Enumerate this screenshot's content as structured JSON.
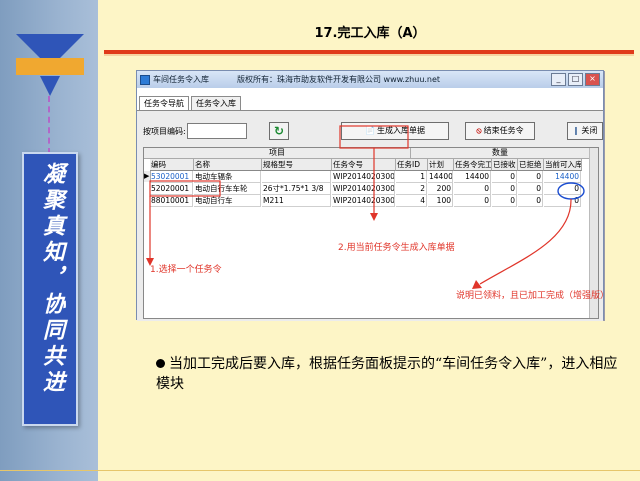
{
  "slide": {
    "title": "17.完工入库（A）",
    "sidebar_text": "凝聚真知，协同共进",
    "bullet": "当加工完成后要入库，根据任务面板提示的“车间任务令入库”，进入相应模块"
  },
  "window": {
    "title": "车间任务令入库",
    "copyright": "版权所有：珠海市助友软件开发有限公司 www.zhuu.net",
    "tabs": [
      "任务令导航",
      "任务令入库"
    ],
    "buttons": {
      "minimize": "_",
      "maximize": "□",
      "close": "×"
    }
  },
  "toolbar": {
    "project_code_label": "按项目编码:",
    "project_code_value": "",
    "generate_label": "生成入库单据",
    "end_task_label": "结束任务令",
    "close_label": "关闭"
  },
  "grid": {
    "group_headers": {
      "project": "项目",
      "quantity": "数量"
    },
    "columns": [
      "编码",
      "名称",
      "规格型号",
      "任务令号",
      "任务ID",
      "计划",
      "任务令完工",
      "已接收",
      "已拒绝",
      "当前可入库"
    ],
    "rows": [
      {
        "code": "53020001",
        "name": "电动车辐条",
        "spec": "",
        "order": "WIP20140203001",
        "task_id": "1",
        "plan": "14400",
        "done": "14400",
        "received": "0",
        "rejected": "0",
        "available": "14400"
      },
      {
        "code": "52020001",
        "name": "电动自行车车轮",
        "spec": "26寸*1.75*1 3/8",
        "order": "WIP20140203002",
        "task_id": "2",
        "plan": "200",
        "done": "0",
        "received": "0",
        "rejected": "0",
        "available": "0"
      },
      {
        "code": "88010001",
        "name": "电动自行车",
        "spec": "M211",
        "order": "WIP20140203004",
        "task_id": "4",
        "plan": "100",
        "done": "0",
        "received": "0",
        "rejected": "0",
        "available": "0"
      }
    ]
  },
  "annotations": {
    "step1": "1.选择一个任务令",
    "step2": "2.用当前任务令生成入库单据",
    "note": "说明已领料，且已加工完成（增强版）"
  },
  "colors": {
    "accent_red": "#e0352a",
    "sidebar_blue": "#2f55b8",
    "slide_bg": "#fdf5c6"
  }
}
